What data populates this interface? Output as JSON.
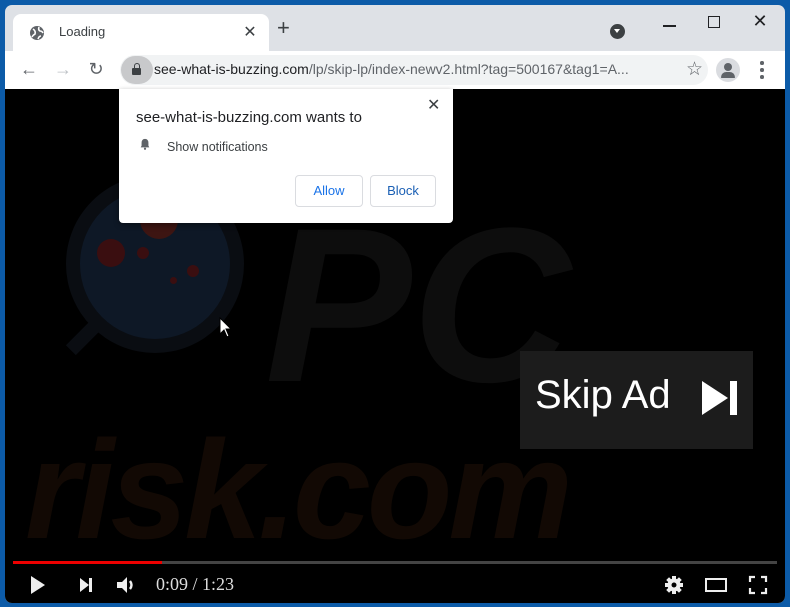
{
  "browser": {
    "tab": {
      "title": "Loading",
      "icon": "globe-icon"
    },
    "new_tab_label": "+",
    "address": {
      "host": "see-what-is-buzzing.com",
      "path": "/lp/skip-lp/index-newv2.html?tag=500167&tag1=A..."
    },
    "icons": {
      "back": "←",
      "forward": "→",
      "reload": "↻",
      "star": "☆",
      "close_tab": "✕",
      "close_window": "✕"
    }
  },
  "notification_popup": {
    "title": "see-what-is-buzzing.com wants to",
    "permission": "Show notifications",
    "allow_label": "Allow",
    "block_label": "Block",
    "close": "✕"
  },
  "video": {
    "skip_ad_label": "Skip Ad",
    "current_time": "0:09",
    "separator": " / ",
    "duration": "1:23",
    "progress_fraction": 0.195,
    "progress_color": "#ee0000"
  },
  "watermark": {
    "text": "risk.com",
    "prefix": "PC"
  }
}
